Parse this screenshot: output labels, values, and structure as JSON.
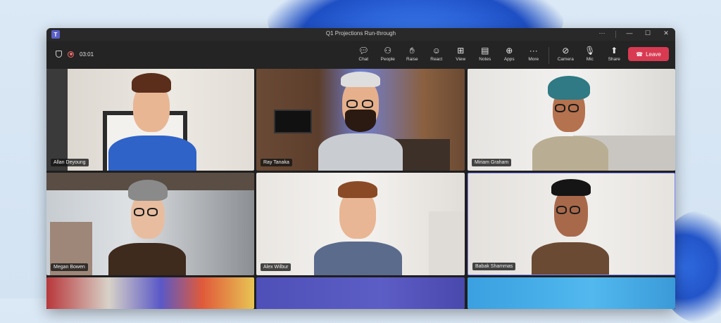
{
  "window": {
    "title": "Q1 Projections Run-through"
  },
  "window_controls": {
    "more": "···",
    "minimize": "—",
    "maximize": "☐",
    "close": "✕"
  },
  "status": {
    "timer": "03:01"
  },
  "toolbar": {
    "items": [
      {
        "label": "Chat",
        "icon": "chat-icon"
      },
      {
        "label": "People",
        "icon": "people-icon"
      },
      {
        "label": "Raise",
        "icon": "raise-hand-icon"
      },
      {
        "label": "React",
        "icon": "react-icon"
      },
      {
        "label": "View",
        "icon": "view-icon"
      },
      {
        "label": "Notes",
        "icon": "notes-icon"
      },
      {
        "label": "Apps",
        "icon": "apps-icon"
      },
      {
        "label": "More",
        "icon": "more-icon"
      },
      {
        "label": "Camera",
        "icon": "camera-icon"
      },
      {
        "label": "Mic",
        "icon": "mic-icon"
      },
      {
        "label": "Share",
        "icon": "share-icon"
      }
    ],
    "leave_label": "Leave"
  },
  "participants": [
    {
      "name": "Allan Deyoung"
    },
    {
      "name": "Ray Tanaka"
    },
    {
      "name": "Miriam Graham"
    },
    {
      "name": "Megan Bowen"
    },
    {
      "name": "Alex Wilbur"
    },
    {
      "name": "Babak Shammas"
    }
  ],
  "colors": {
    "accent_leave": "#d83a52",
    "active_speaker": "#7f85f5",
    "window_bg": "#1f1f1f"
  }
}
